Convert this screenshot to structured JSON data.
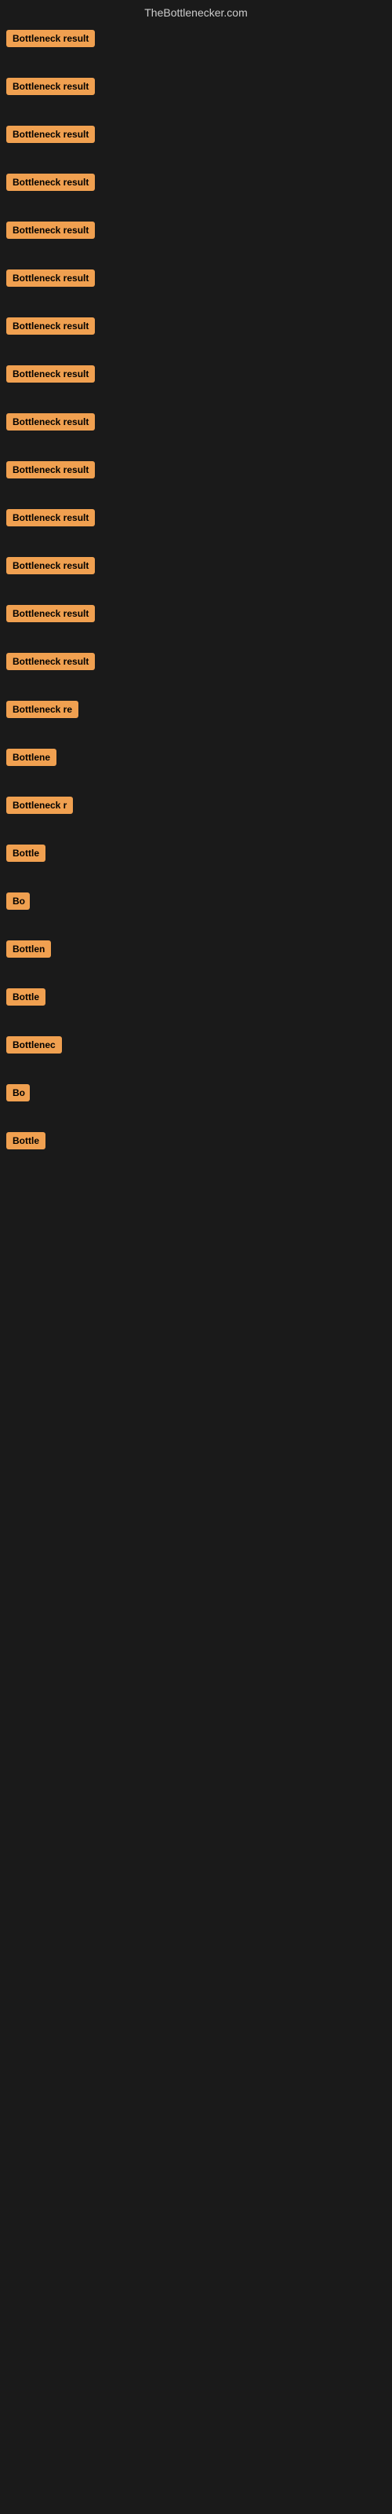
{
  "site": {
    "title": "TheBottlenecker.com"
  },
  "rows": [
    {
      "id": 1,
      "label": "Bottleneck result",
      "widthClass": "badge-full",
      "rowOffset": 57
    },
    {
      "id": 2,
      "label": "Bottleneck result",
      "widthClass": "badge-full",
      "rowOffset": 143
    },
    {
      "id": 3,
      "label": "Bottleneck result",
      "widthClass": "badge-full",
      "rowOffset": 234
    },
    {
      "id": 4,
      "label": "Bottleneck result",
      "widthClass": "badge-full",
      "rowOffset": 321
    },
    {
      "id": 5,
      "label": "Bottleneck result",
      "widthClass": "badge-full",
      "rowOffset": 411
    },
    {
      "id": 6,
      "label": "Bottleneck result",
      "widthClass": "badge-full",
      "rowOffset": 500
    },
    {
      "id": 7,
      "label": "Bottleneck result",
      "widthClass": "badge-full",
      "rowOffset": 587
    },
    {
      "id": 8,
      "label": "Bottleneck result",
      "widthClass": "badge-full",
      "rowOffset": 676
    },
    {
      "id": 9,
      "label": "Bottleneck result",
      "widthClass": "badge-full",
      "rowOffset": 762
    },
    {
      "id": 10,
      "label": "Bottleneck result",
      "widthClass": "badge-full",
      "rowOffset": 851
    },
    {
      "id": 11,
      "label": "Bottleneck result",
      "widthClass": "badge-full",
      "rowOffset": 940
    },
    {
      "id": 12,
      "label": "Bottleneck result",
      "widthClass": "badge-full",
      "rowOffset": 1028
    },
    {
      "id": 13,
      "label": "Bottleneck result",
      "widthClass": "badge-full",
      "rowOffset": 1115
    },
    {
      "id": 14,
      "label": "Bottleneck result",
      "widthClass": "badge-full",
      "rowOffset": 1204
    },
    {
      "id": 15,
      "label": "Bottleneck re",
      "widthClass": "badge-w1",
      "rowOffset": 1293
    },
    {
      "id": 16,
      "label": "Bottlene",
      "widthClass": "badge-w2",
      "rowOffset": 1375
    },
    {
      "id": 17,
      "label": "Bottleneck r",
      "widthClass": "badge-w1",
      "rowOffset": 1458
    },
    {
      "id": 18,
      "label": "Bottle",
      "widthClass": "badge-w2",
      "rowOffset": 1540
    },
    {
      "id": 19,
      "label": "Bo",
      "widthClass": "badge-w7",
      "rowOffset": 1620
    },
    {
      "id": 20,
      "label": "Bottlen",
      "widthClass": "badge-w2",
      "rowOffset": 1703
    },
    {
      "id": 21,
      "label": "Bottle",
      "widthClass": "badge-w3",
      "rowOffset": 1783
    },
    {
      "id": 22,
      "label": "Bottlenec",
      "widthClass": "badge-w2",
      "rowOffset": 1865
    },
    {
      "id": 23,
      "label": "Bo",
      "widthClass": "badge-w7",
      "rowOffset": 1945
    },
    {
      "id": 24,
      "label": "Bottle",
      "widthClass": "badge-w3",
      "rowOffset": 2028
    }
  ],
  "colors": {
    "badge_bg": "#f0a050",
    "badge_text": "#000000",
    "background": "#1a1a1a",
    "title_text": "#cccccc"
  }
}
